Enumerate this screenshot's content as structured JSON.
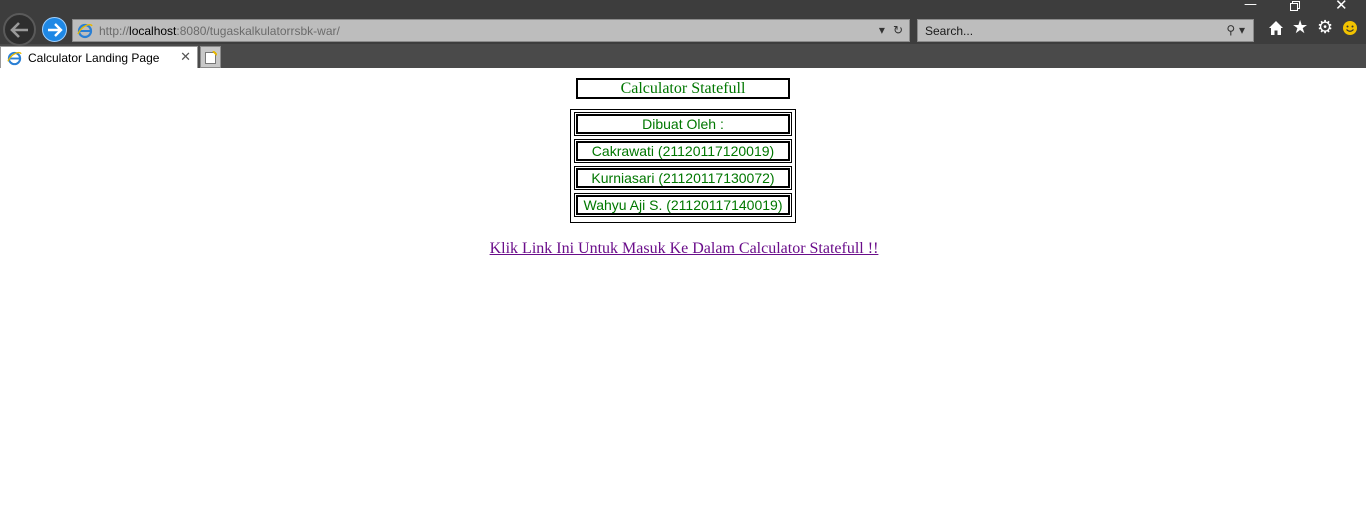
{
  "browser": {
    "address": {
      "url_prefix": "http://",
      "url_host": "localhost",
      "url_rest": ":8080/tugaskalkulatorrsbk-war/"
    },
    "search": {
      "placeholder": "Search..."
    },
    "tab": {
      "title": "Calculator Landing Page"
    },
    "icons": {
      "back": "back-arrow-icon",
      "forward": "forward-arrow-icon",
      "refresh": "refresh-icon",
      "home": "home-icon",
      "favorites": "star-icon",
      "tools": "gear-icon",
      "feedback": "smiley-icon"
    },
    "colors": {
      "chrome": "#4a4a4a",
      "forward_button": "#1e88e5"
    }
  },
  "page": {
    "title": "Calculator Statefull",
    "made_by_label": "Dibuat Oleh :",
    "authors": [
      "Cakrawati (21120117120019)",
      "Kurniasari (21120117130072)",
      "Wahyu Aji S. (21120117140019)"
    ],
    "link_text": "Klik Link Ini Untuk Masuk Ke Dalam Calculator Statefull !!",
    "colors": {
      "text": "#007700",
      "link": "#6a0d8a"
    }
  }
}
